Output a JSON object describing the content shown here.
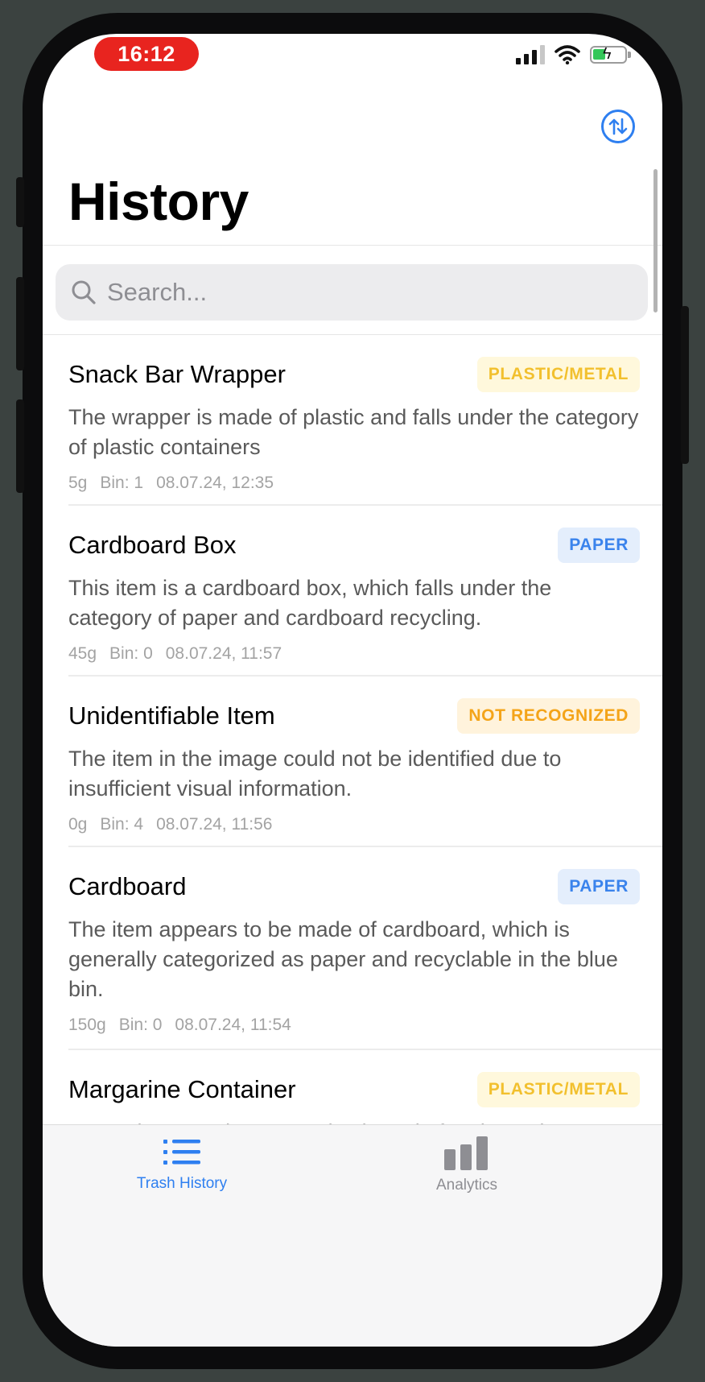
{
  "status_bar": {
    "time": "16:12",
    "icons": [
      "cellular-signal-icon",
      "wifi-icon",
      "battery-charging-icon"
    ]
  },
  "header": {
    "title": "History",
    "sort_icon": "sort-arrows-icon"
  },
  "search": {
    "placeholder": "Search...",
    "value": ""
  },
  "items": [
    {
      "title": "Snack Bar Wrapper",
      "category": "PLASTIC/METAL",
      "category_color": "#f2c02e",
      "description": "The wrapper is made of plastic and falls under the category of plastic containers",
      "weight": "5g",
      "bin": "Bin: 1",
      "datetime": "08.07.24, 12:35"
    },
    {
      "title": "Cardboard Box",
      "category": "PAPER",
      "category_color": "#3a83ec",
      "description": "This item is a cardboard box, which falls under the category of paper and cardboard recycling.",
      "weight": "45g",
      "bin": "Bin: 0",
      "datetime": "08.07.24, 11:57"
    },
    {
      "title": "Unidentifiable Item",
      "category": "NOT RECOGNIZED",
      "category_color": "#f4a419",
      "description": "The item in the image could not be identified due to insufficient visual information.",
      "weight": "0g",
      "bin": "Bin: 4",
      "datetime": "08.07.24, 11:56"
    },
    {
      "title": "Cardboard",
      "category": "PAPER",
      "category_color": "#3a83ec",
      "description": "The item appears to be made of cardboard, which is generally categorized as paper and recyclable in the blue bin.",
      "weight": "150g",
      "bin": "Bin: 0",
      "datetime": "08.07.24, 11:54"
    },
    {
      "title": "Margarine Container",
      "category": "PLASTIC/METAL",
      "category_color": "#f2c02e",
      "description": "Margarine containers are plastic and often have the"
    }
  ],
  "tabs": [
    {
      "label": "Trash History",
      "icon": "list-icon",
      "active": true
    },
    {
      "label": "Analytics",
      "icon": "bar-chart-icon",
      "active": false
    }
  ],
  "colors": {
    "accent": "#2e7ff0",
    "time_pill": "#e8241f"
  }
}
